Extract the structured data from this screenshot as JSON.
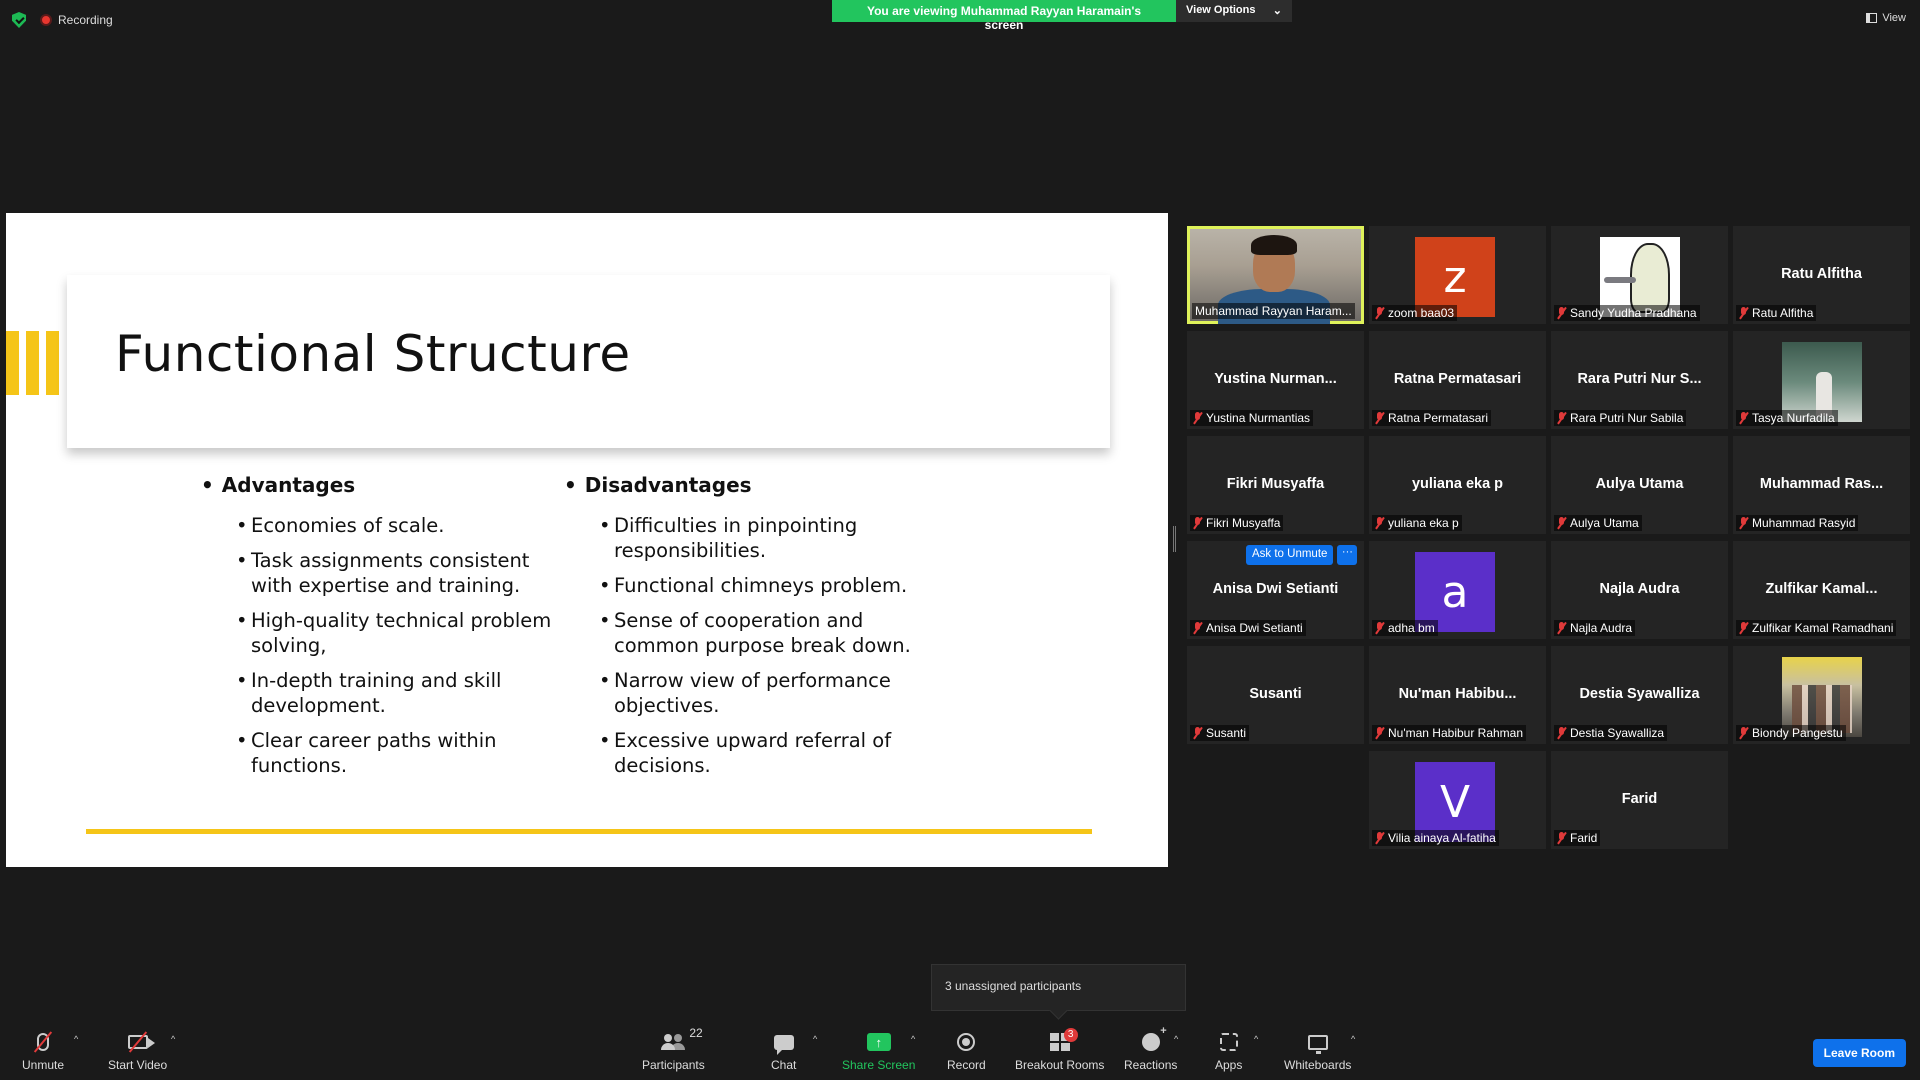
{
  "top": {
    "recording_label": "Recording",
    "banner_text": "You are viewing Muhammad Rayyan Haramain's screen",
    "view_options": "View Options",
    "view_options_caret": "⌄",
    "view_label": "View"
  },
  "slide": {
    "title": "Functional Structure",
    "advantages_head": "Advantages",
    "advantages": [
      "Economies of scale.",
      "Task assignments consistent with expertise and training.",
      "High-quality technical problem solving,",
      "In-depth training and skill development.",
      "Clear career paths within functions."
    ],
    "disadvantages_head": "Disadvantages",
    "disadvantages": [
      "Difficulties in pinpointing responsibilities.",
      "Functional chimneys problem.",
      "Sense of cooperation and common purpose break down.",
      "Narrow view of performance objectives.",
      "Excessive upward referral of decisions."
    ]
  },
  "gallery": {
    "tiles": [
      {
        "center": "",
        "label": "Muhammad Rayyan Haram...",
        "kind": "camera",
        "muted": false,
        "active": true
      },
      {
        "center": "",
        "label": "zoom baa03",
        "kind": "letter",
        "letter": "z",
        "color": "#d0421a",
        "muted": true
      },
      {
        "center": "",
        "label": "Sandy Yudha Pradhana",
        "kind": "bear",
        "muted": true
      },
      {
        "center": "Ratu Alfitha",
        "label": "Ratu Alfitha",
        "kind": "name",
        "muted": true
      },
      {
        "center": "Yustina  Nurman...",
        "label": "Yustina Nurmantias",
        "kind": "name",
        "muted": true
      },
      {
        "center": "Ratna Permatasari",
        "label": "Ratna Permatasari",
        "kind": "name",
        "muted": true
      },
      {
        "center": "Rara Putri Nur S...",
        "label": "Rara Putri Nur Sabila",
        "kind": "name",
        "muted": true
      },
      {
        "center": "",
        "label": "Tasya Nurfadila",
        "kind": "photo1",
        "muted": true
      },
      {
        "center": "Fikri Musyaffa",
        "label": "Fikri Musyaffa",
        "kind": "name",
        "muted": true
      },
      {
        "center": "yuliana eka p",
        "label": "yuliana eka p",
        "kind": "name",
        "muted": true
      },
      {
        "center": "Aulya Utama",
        "label": "Aulya Utama",
        "kind": "name",
        "muted": true
      },
      {
        "center": "Muhammad  Ras...",
        "label": "Muhammad Rasyid",
        "kind": "name",
        "muted": true
      },
      {
        "center": "Anisa Dwi Setianti",
        "label": "Anisa Dwi Setianti",
        "kind": "name",
        "muted": true
      },
      {
        "center": "",
        "label": "adha bm",
        "kind": "letter",
        "letter": "a",
        "color": "#5b2fc9",
        "muted": true,
        "ask": true
      },
      {
        "center": "Najla Audra",
        "label": "Najla Audra",
        "kind": "name",
        "muted": true
      },
      {
        "center": "Zulfikar  Kamal...",
        "label": "Zulfikar Kamal Ramadhani",
        "kind": "name",
        "muted": true
      },
      {
        "center": "Susanti",
        "label": "Susanti",
        "kind": "name",
        "muted": true
      },
      {
        "center": "Nu'man  Habibu...",
        "label": "Nu'man Habibur Rahman",
        "kind": "name",
        "muted": true
      },
      {
        "center": "Destia Syawalliza",
        "label": "Destia Syawalliza",
        "kind": "name",
        "muted": true
      },
      {
        "center": "",
        "label": "Biondy Pangestu",
        "kind": "photo2",
        "muted": true
      },
      {
        "center": "",
        "label": "",
        "kind": "empty",
        "muted": false
      },
      {
        "center": "",
        "label": "Vilia ainaya Al-fatiha",
        "kind": "letter",
        "letter": "V",
        "color": "#5b2fc9",
        "muted": true
      },
      {
        "center": "Farid",
        "label": "Farid",
        "kind": "name",
        "muted": true
      }
    ],
    "ask_to_unmute": "Ask to Unmute",
    "more": "···"
  },
  "tooltip": "3 unassigned participants",
  "toolbar": {
    "unmute": "Unmute",
    "start_video": "Start Video",
    "participants": "Participants",
    "participants_count": "22",
    "chat": "Chat",
    "share_screen": "Share Screen",
    "share_arrow": "↑",
    "record": "Record",
    "breakout_rooms": "Breakout Rooms",
    "breakout_badge": "3",
    "reactions": "Reactions",
    "apps": "Apps",
    "whiteboards": "Whiteboards",
    "leave_room": "Leave Room",
    "caret": "^"
  }
}
